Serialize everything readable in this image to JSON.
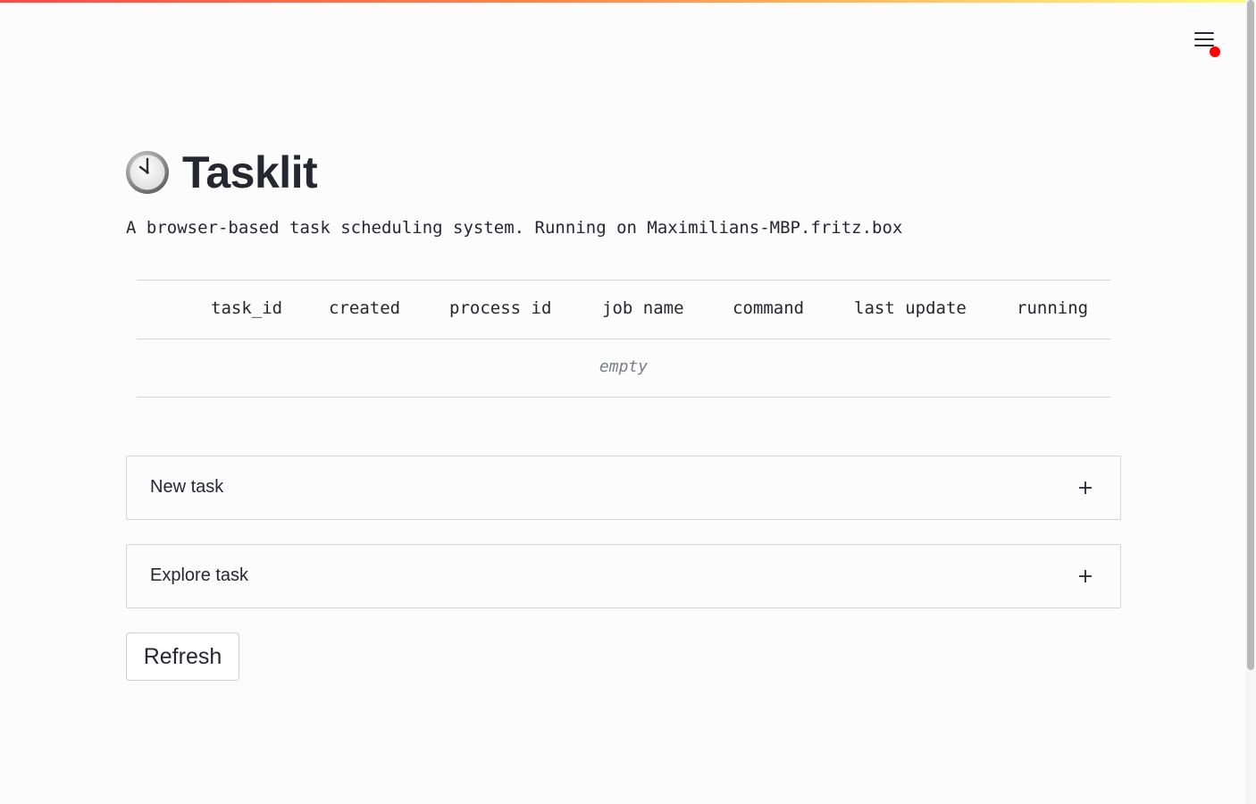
{
  "app": {
    "title": "Tasklit",
    "subtitle": "A browser-based task scheduling system. Running on Maximilians-MBP.fritz.box",
    "title_icon": "clock-icon"
  },
  "header": {
    "menu_icon": "hamburger-menu-icon",
    "notification_color": "#ff0000",
    "decoration_colors": [
      "#ff4b4b",
      "#fffd80"
    ]
  },
  "table": {
    "columns": [
      "task_id",
      "created",
      "process id",
      "job name",
      "command",
      "last update",
      "running"
    ],
    "empty_text": "empty"
  },
  "expanders": [
    {
      "label": "New task",
      "icon": "plus-icon"
    },
    {
      "label": "Explore task",
      "icon": "plus-icon"
    }
  ],
  "refresh_button": {
    "label": "Refresh"
  }
}
